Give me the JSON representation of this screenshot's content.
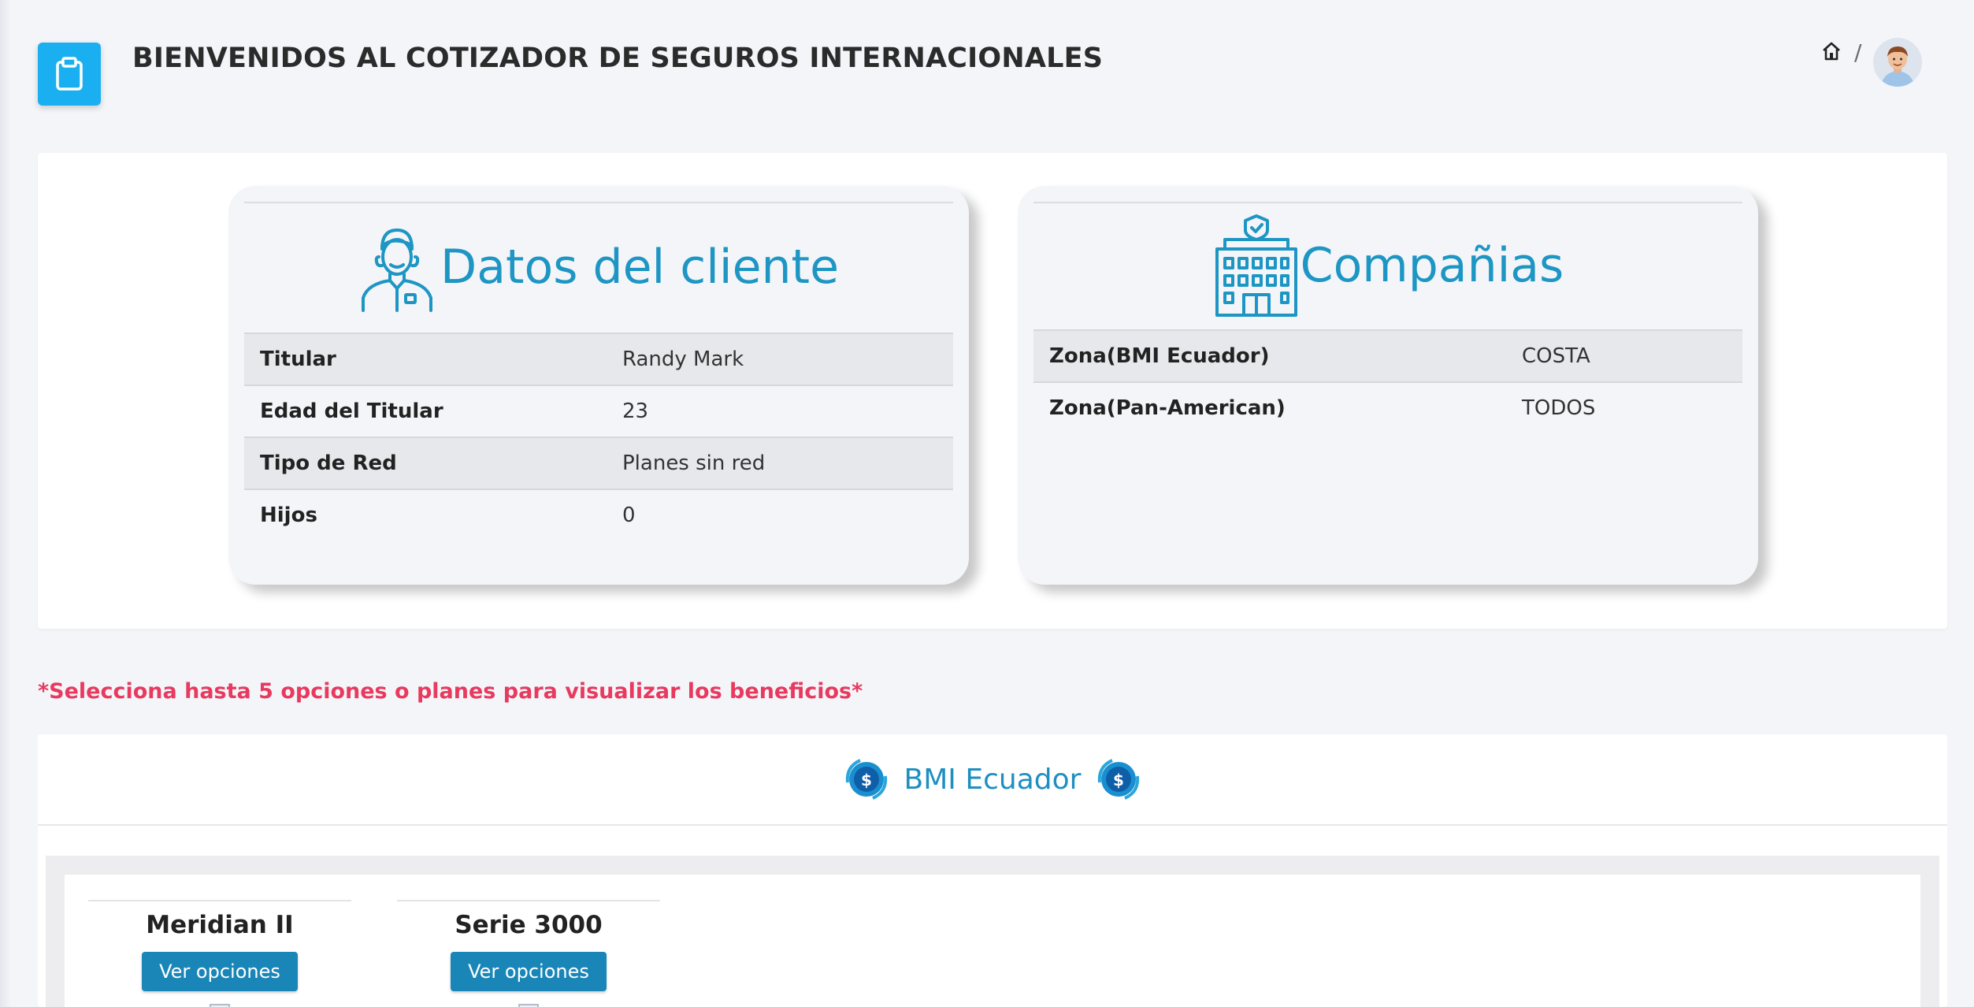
{
  "header": {
    "title": "BIENVENIDOS AL COTIZADOR DE SEGUROS INTERNACIONALES",
    "breadcrumb_separator": "/",
    "icons": {
      "app": "clipboard-icon",
      "home": "home-icon",
      "avatar": "user-avatar"
    }
  },
  "client": {
    "title": "Datos del cliente",
    "icon": "person-icon",
    "rows": [
      {
        "label": "Titular",
        "value": "Randy Mark"
      },
      {
        "label": "Edad del Titular",
        "value": "23"
      },
      {
        "label": "Tipo de Red",
        "value": "Planes sin red"
      },
      {
        "label": "Hijos",
        "value": "0"
      }
    ]
  },
  "companies": {
    "title": "Compañias",
    "icon": "hospital-building-icon",
    "rows": [
      {
        "label": "Zona(BMI Ecuador)",
        "value": "COSTA"
      },
      {
        "label": "Zona(Pan-American)",
        "value": "TODOS"
      }
    ]
  },
  "notice": "*Selecciona hasta 5 opciones o planes para visualizar los beneficios*",
  "company_section": {
    "name": "BMI Ecuador",
    "icon": "dollar-coin-icon",
    "plans": [
      {
        "name": "Meridian II",
        "button": "Ver opciones"
      },
      {
        "name": "Serie 3000",
        "button": "Ver opciones"
      }
    ]
  },
  "colors": {
    "accent": "#1aaff0",
    "heading_blue": "#1e96c4",
    "button_blue": "#1a86b8",
    "notice_red": "#e83a5f",
    "background": "#f4f5f9"
  }
}
